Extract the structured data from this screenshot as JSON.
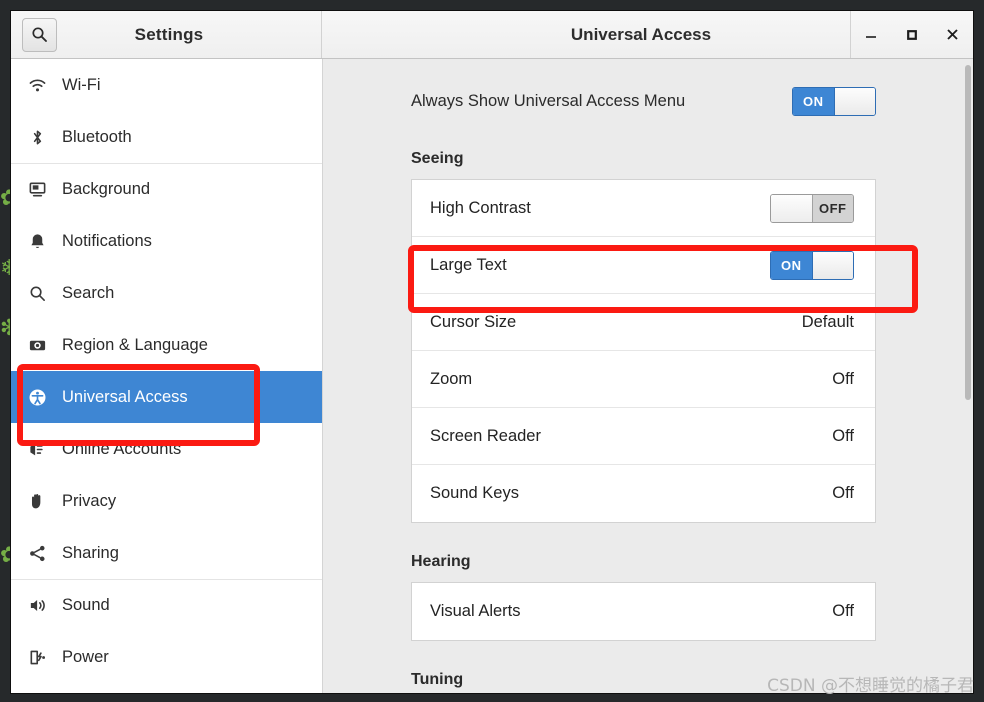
{
  "window": {
    "sidebar_title": "Settings",
    "content_title": "Universal Access",
    "search_icon": "search-icon",
    "controls": {
      "minimize": "minimize-icon",
      "maximize": "maximize-icon",
      "close": "close-icon"
    }
  },
  "sidebar": {
    "items": [
      {
        "label": "Wi-Fi",
        "icon": "wifi-icon",
        "selected": false,
        "separator_above": false
      },
      {
        "label": "Bluetooth",
        "icon": "bluetooth-icon",
        "selected": false,
        "separator_above": false
      },
      {
        "label": "Background",
        "icon": "background-icon",
        "selected": false,
        "separator_above": true
      },
      {
        "label": "Notifications",
        "icon": "bell-icon",
        "selected": false,
        "separator_above": false
      },
      {
        "label": "Search",
        "icon": "search-icon",
        "selected": false,
        "separator_above": false
      },
      {
        "label": "Region & Language",
        "icon": "region-language-icon",
        "selected": false,
        "separator_above": false
      },
      {
        "label": "Universal Access",
        "icon": "universal-access-icon",
        "selected": true,
        "separator_above": false
      },
      {
        "label": "Online Accounts",
        "icon": "online-accounts-icon",
        "selected": false,
        "separator_above": false
      },
      {
        "label": "Privacy",
        "icon": "privacy-hand-icon",
        "selected": false,
        "separator_above": false
      },
      {
        "label": "Sharing",
        "icon": "sharing-icon",
        "selected": false,
        "separator_above": false
      },
      {
        "label": "Sound",
        "icon": "speaker-icon",
        "selected": false,
        "separator_above": true
      },
      {
        "label": "Power",
        "icon": "power-battery-icon",
        "selected": false,
        "separator_above": false
      }
    ]
  },
  "content": {
    "always_show_menu": {
      "label": "Always Show Universal Access Menu",
      "state": "ON"
    },
    "seeing": {
      "title": "Seeing",
      "rows": [
        {
          "label": "High Contrast",
          "type": "toggle",
          "state": "OFF"
        },
        {
          "label": "Large Text",
          "type": "toggle",
          "state": "ON"
        },
        {
          "label": "Cursor Size",
          "type": "value",
          "value": "Default"
        },
        {
          "label": "Zoom",
          "type": "value",
          "value": "Off"
        },
        {
          "label": "Screen Reader",
          "type": "value",
          "value": "Off"
        },
        {
          "label": "Sound Keys",
          "type": "value",
          "value": "Off"
        }
      ]
    },
    "hearing": {
      "title": "Hearing",
      "rows": [
        {
          "label": "Visual Alerts",
          "type": "value",
          "value": "Off"
        }
      ]
    },
    "typing": {
      "title": "Tuning"
    }
  },
  "annotations": {
    "highlight_color": "#fb1a12",
    "boxes": [
      {
        "name": "universal-access-sidebar-highlight"
      },
      {
        "name": "large-text-row-highlight"
      }
    ]
  },
  "watermark": {
    "text": "CSDN @不想睡觉的橘子君"
  },
  "colors": {
    "selection_blue": "#3e86d3",
    "toggle_on_blue": "#3d86d4",
    "content_bg": "#ebebeb",
    "desktop_bg": "#26292b"
  }
}
